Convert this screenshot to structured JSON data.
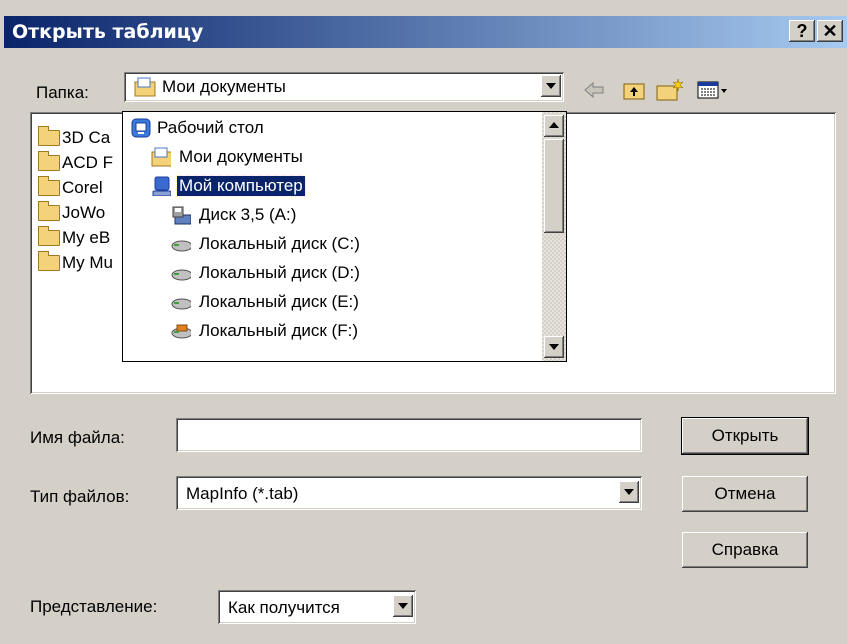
{
  "window": {
    "title": "Открыть таблицу",
    "help_label": "?",
    "close_label": "✕"
  },
  "folder_label": "Папка:",
  "folder_combo": {
    "value": "Мои документы"
  },
  "folders": [
    "3D Ca",
    "ACD F",
    "Corel",
    "JoWo",
    "My eB",
    "My Mu"
  ],
  "dropdown": {
    "items": [
      {
        "label": "Рабочий стол",
        "icon": "desktop-icon"
      },
      {
        "label": "Мои документы",
        "icon": "documents-folder-icon"
      },
      {
        "label": "Мой компьютер",
        "icon": "computer-icon",
        "selected": true
      },
      {
        "label": "Диск 3,5 (A:)",
        "icon": "floppy-icon"
      },
      {
        "label": "Локальный диск (C:)",
        "icon": "hard-drive-icon"
      },
      {
        "label": "Локальный диск (D:)",
        "icon": "hard-drive-icon"
      },
      {
        "label": "Локальный диск (E:)",
        "icon": "hard-drive-icon"
      },
      {
        "label": "Локальный диск (F:)",
        "icon": "hard-drive-icon"
      }
    ]
  },
  "filename": {
    "label": "Имя файла:",
    "value": ""
  },
  "filetype": {
    "label": "Тип файлов:",
    "value": "MapInfo (*.tab)"
  },
  "view": {
    "label": "Представление:",
    "value": "Как получится"
  },
  "buttons": {
    "open": "Открыть",
    "cancel": "Отмена",
    "help": "Справка"
  },
  "colors": {
    "title_start": "#0a246a",
    "title_end": "#a6caf0",
    "selection": "#0a246a",
    "face": "#d4d0c8"
  }
}
